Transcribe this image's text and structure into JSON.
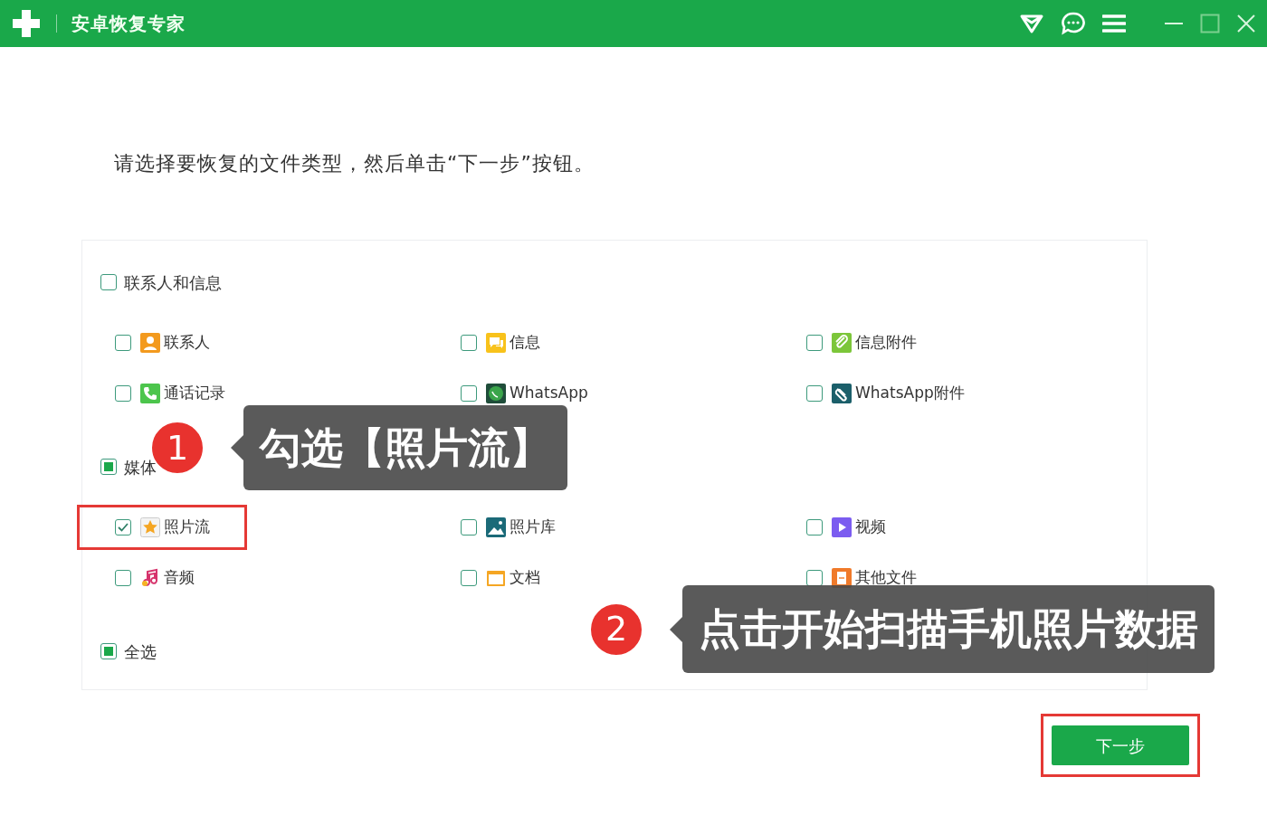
{
  "window": {
    "title": "安卓恢复专家"
  },
  "instruction": "请选择要恢复的文件类型，然后单击“下一步”按钮。",
  "groups": [
    {
      "label": "联系人和信息",
      "checked": false,
      "partial": false,
      "items": [
        {
          "label": "联系人",
          "kind": "contact",
          "checked": false,
          "highlighted": false
        },
        {
          "label": "信息",
          "kind": "message",
          "checked": false,
          "highlighted": false
        },
        {
          "label": "信息附件",
          "kind": "attachment",
          "checked": false,
          "highlighted": false
        },
        {
          "label": "通话记录",
          "kind": "call",
          "checked": false,
          "highlighted": false
        },
        {
          "label": "WhatsApp",
          "kind": "whatsapp",
          "checked": false,
          "highlighted": false
        },
        {
          "label": "WhatsApp附件",
          "kind": "whatsapp_attachment",
          "checked": false,
          "highlighted": false
        }
      ]
    },
    {
      "label": "媒体",
      "checked": false,
      "partial": true,
      "items": [
        {
          "label": "照片流",
          "kind": "photostream",
          "checked": true,
          "highlighted": true
        },
        {
          "label": "照片库",
          "kind": "gallery",
          "checked": false,
          "highlighted": false
        },
        {
          "label": "视频",
          "kind": "video",
          "checked": false,
          "highlighted": false
        },
        {
          "label": "音频",
          "kind": "audio",
          "checked": false,
          "highlighted": false
        },
        {
          "label": "文档",
          "kind": "document",
          "checked": false,
          "highlighted": false
        },
        {
          "label": "其他文件",
          "kind": "other",
          "checked": false,
          "highlighted": false
        }
      ]
    }
  ],
  "select_all": {
    "label": "全选",
    "checked": false,
    "partial": true
  },
  "next_button": {
    "label": "下一步",
    "highlighted": true
  },
  "callouts": [
    {
      "number": "1",
      "text": "勾选【照片流】"
    },
    {
      "number": "2",
      "text": "点击开始扫描手机照片数据"
    }
  ]
}
